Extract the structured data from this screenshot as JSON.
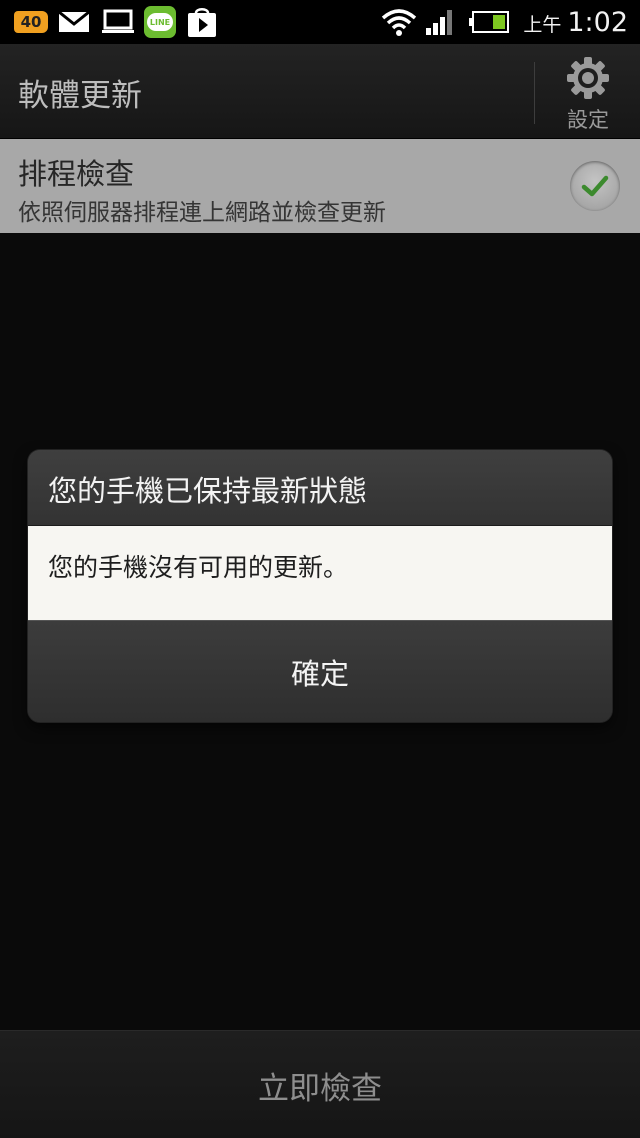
{
  "status_bar": {
    "notification_count": "40",
    "line_label": "LINE",
    "ampm": "上午",
    "time": "1:02",
    "icons": [
      "badge-40",
      "mail-icon",
      "media-icon",
      "line-icon",
      "play-store-icon",
      "wifi-icon",
      "signal-icon",
      "battery-icon"
    ],
    "battery_color": "#7ec820"
  },
  "action_bar": {
    "title": "軟體更新",
    "settings_label": "設定",
    "settings_icon": "gear-icon"
  },
  "scheduled_check": {
    "title": "排程檢查",
    "summary": "依照伺服器排程連上網路並檢查更新",
    "checked": true,
    "check_color": "#3c8a2e"
  },
  "dialog": {
    "title": "您的手機已保持最新狀態",
    "message": "您的手機沒有可用的更新。",
    "ok_label": "確定"
  },
  "bottom_bar": {
    "check_now_label": "立即檢查"
  }
}
